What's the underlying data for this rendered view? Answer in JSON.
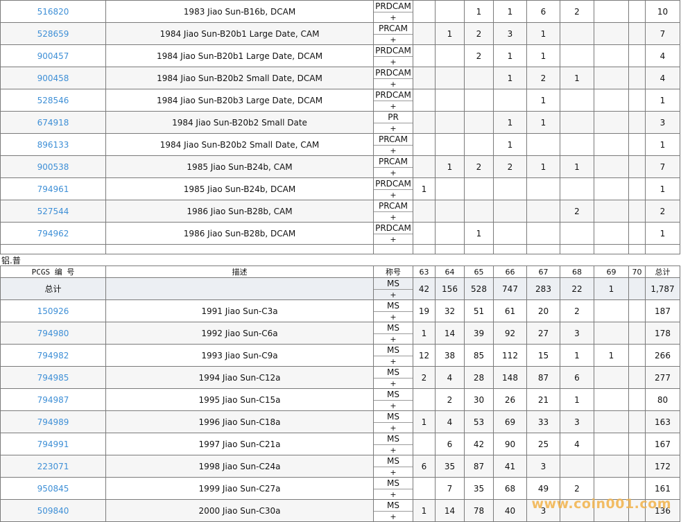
{
  "top_rows": [
    {
      "pcgs": "516820",
      "desc": "1983 Jiao Sun-B16b, DCAM",
      "grade": "PRDCAM",
      "plus": "+",
      "c": [
        "",
        "",
        "1",
        "1",
        "6",
        "2",
        "",
        ""
      ],
      "total": "10"
    },
    {
      "pcgs": "528659",
      "desc": "1984 Jiao Sun-B20b1 Large Date, CAM",
      "grade": "PRCAM",
      "plus": "+",
      "c": [
        "",
        "1",
        "2",
        "3",
        "1",
        "",
        "",
        ""
      ],
      "total": "7"
    },
    {
      "pcgs": "900457",
      "desc": "1984 Jiao Sun-B20b1 Large Date, DCAM",
      "grade": "PRDCAM",
      "plus": "+",
      "c": [
        "",
        "",
        "2",
        "1",
        "1",
        "",
        "",
        ""
      ],
      "total": "4"
    },
    {
      "pcgs": "900458",
      "desc": "1984 Jiao Sun-B20b2 Small Date, DCAM",
      "grade": "PRDCAM",
      "plus": "+",
      "c": [
        "",
        "",
        "",
        "1",
        "2",
        "1",
        "",
        ""
      ],
      "total": "4"
    },
    {
      "pcgs": "528546",
      "desc": "1984 Jiao Sun-B20b3 Large Date, DCAM",
      "grade": "PRDCAM",
      "plus": "+",
      "c": [
        "",
        "",
        "",
        "",
        "1",
        "",
        "",
        ""
      ],
      "total": "1"
    },
    {
      "pcgs": "674918",
      "desc": "1984 Jiao Sun-B20b2 Small Date",
      "grade": "PR",
      "plus": "+",
      "c": [
        "",
        "",
        "",
        "1",
        "1",
        "",
        "",
        ""
      ],
      "total": "3"
    },
    {
      "pcgs": "896133",
      "desc": "1984 Jiao Sun-B20b2 Small Date, CAM",
      "grade": "PRCAM",
      "plus": "+",
      "c": [
        "",
        "",
        "",
        "1",
        "",
        "",
        "",
        ""
      ],
      "total": "1"
    },
    {
      "pcgs": "900538",
      "desc": "1985 Jiao Sun-B24b, CAM",
      "grade": "PRCAM",
      "plus": "+",
      "c": [
        "",
        "1",
        "2",
        "2",
        "1",
        "1",
        "",
        ""
      ],
      "total": "7"
    },
    {
      "pcgs": "794961",
      "desc": "1985 Jiao Sun-B24b, DCAM",
      "grade": "PRDCAM",
      "plus": "+",
      "c": [
        "1",
        "",
        "",
        "",
        "",
        "",
        "",
        ""
      ],
      "total": "1"
    },
    {
      "pcgs": "527544",
      "desc": "1986 Jiao Sun-B28b, CAM",
      "grade": "PRCAM",
      "plus": "+",
      "c": [
        "",
        "",
        "",
        "",
        "",
        "2",
        "",
        ""
      ],
      "total": "2"
    },
    {
      "pcgs": "794962",
      "desc": "1986 Jiao Sun-B28b, DCAM",
      "grade": "PRDCAM",
      "plus": "+",
      "c": [
        "",
        "",
        "1",
        "",
        "",
        "",
        "",
        ""
      ],
      "total": "1"
    }
  ],
  "section_title": "铝.普",
  "header": {
    "pcgs": "PCGS 编 号",
    "desc": "描述",
    "grade": "称号",
    "cols": [
      "63",
      "64",
      "65",
      "66",
      "67",
      "68",
      "69",
      "70"
    ],
    "total": "总计"
  },
  "total_row": {
    "label": "总计",
    "grade": "MS",
    "plus": "+",
    "c": [
      "42",
      "156",
      "528",
      "747",
      "283",
      "22",
      "1",
      ""
    ],
    "total": "1,787"
  },
  "bottom_rows": [
    {
      "pcgs": "150926",
      "desc": "1991 Jiao Sun-C3a",
      "grade": "MS",
      "plus": "+",
      "c": [
        "19",
        "32",
        "51",
        "61",
        "20",
        "2",
        "",
        ""
      ],
      "total": "187"
    },
    {
      "pcgs": "794980",
      "desc": "1992 Jiao Sun-C6a",
      "grade": "MS",
      "plus": "+",
      "c": [
        "1",
        "14",
        "39",
        "92",
        "27",
        "3",
        "",
        ""
      ],
      "total": "178"
    },
    {
      "pcgs": "794982",
      "desc": "1993 Jiao Sun-C9a",
      "grade": "MS",
      "plus": "+",
      "c": [
        "12",
        "38",
        "85",
        "112",
        "15",
        "1",
        "1",
        ""
      ],
      "total": "266"
    },
    {
      "pcgs": "794985",
      "desc": "1994 Jiao Sun-C12a",
      "grade": "MS",
      "plus": "+",
      "c": [
        "2",
        "4",
        "28",
        "148",
        "87",
        "6",
        "",
        ""
      ],
      "total": "277"
    },
    {
      "pcgs": "794987",
      "desc": "1995 Jiao Sun-C15a",
      "grade": "MS",
      "plus": "+",
      "c": [
        "",
        "2",
        "30",
        "26",
        "21",
        "1",
        "",
        ""
      ],
      "total": "80"
    },
    {
      "pcgs": "794989",
      "desc": "1996 Jiao Sun-C18a",
      "grade": "MS",
      "plus": "+",
      "c": [
        "1",
        "4",
        "53",
        "69",
        "33",
        "3",
        "",
        ""
      ],
      "total": "163"
    },
    {
      "pcgs": "794991",
      "desc": "1997 Jiao Sun-C21a",
      "grade": "MS",
      "plus": "+",
      "c": [
        "",
        "6",
        "42",
        "90",
        "25",
        "4",
        "",
        ""
      ],
      "total": "167"
    },
    {
      "pcgs": "223071",
      "desc": "1998 Jiao Sun-C24a",
      "grade": "MS",
      "plus": "+",
      "c": [
        "6",
        "35",
        "87",
        "41",
        "3",
        "",
        "",
        ""
      ],
      "total": "172"
    },
    {
      "pcgs": "950845",
      "desc": "1999 Jiao Sun-C27a",
      "grade": "MS",
      "plus": "+",
      "c": [
        "",
        "7",
        "35",
        "68",
        "49",
        "2",
        "",
        ""
      ],
      "total": "161"
    },
    {
      "pcgs": "509840",
      "desc": "2000 Jiao Sun-C30a",
      "grade": "MS",
      "plus": "+",
      "c": [
        "1",
        "14",
        "78",
        "40",
        "3",
        "",
        "",
        ""
      ],
      "total": "136"
    }
  ],
  "watermark": "www.coin001.com",
  "colors": {
    "link": "#3e8fd6",
    "border": "#7a7a7a",
    "total_bg": "#eceff3",
    "watermark": "#f2b24a"
  }
}
